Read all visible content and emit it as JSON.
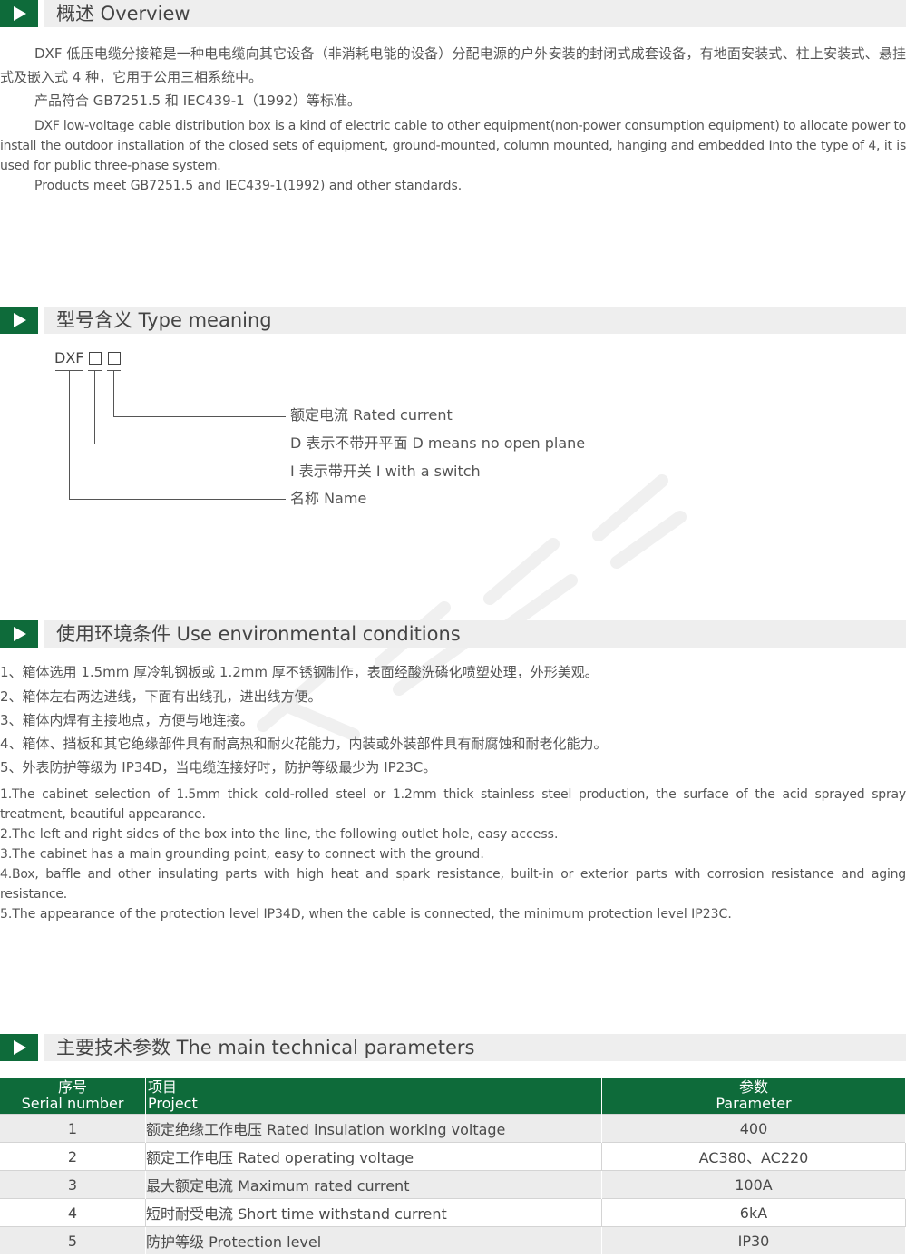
{
  "sections": {
    "overview": {
      "title": "概述 Overview",
      "paragraphs": [
        "DXF 低压电缆分接箱是一种电电缆向其它设备（非消耗电能的设备）分配电源的户外安装的封闭式成套设备，有地面安装式、柱上安装式、悬挂式及嵌入式 4 种，它用于公用三相系统中。",
        "产品符合 GB7251.5 和 IEC439-1（1992）等标准。",
        "DXF low-voltage cable distribution box is a kind of electric cable to other equipment(non-power consumption equipment) to allocate power to install the outdoor installation of the closed sets of equipment, ground-mounted, column mounted, hanging and embedded Into the type of 4, it is used for public three-phase system.",
        "Products meet GB7251.5 and IEC439-1(1992) and other standards."
      ]
    },
    "type_meaning": {
      "title": "型号含义 Type meaning",
      "code": "DXF",
      "labels": [
        "额定电流 Rated current",
        "D 表示不带开平面 D means no open plane",
        "I 表示带开关 I with a switch",
        "名称 Name"
      ]
    },
    "conditions": {
      "title": "使用环境条件 Use environmental conditions",
      "cn_items": [
        "1、箱体选用 1.5mm 厚冷轧钢板或 1.2mm 厚不锈钢制作，表面经酸洗磷化喷塑处理，外形美观。",
        "2、箱体左右两边进线，下面有出线孔，进出线方便。",
        "3、箱体内焊有主接地点，方便与地连接。",
        "4、箱体、挡板和其它绝缘部件具有耐高热和耐火花能力，内装或外装部件具有耐腐蚀和耐老化能力。",
        "5、外表防护等级为 IP34D，当电缆连接好时，防护等级最少为 IP23C。"
      ],
      "en_items": [
        "1.The cabinet selection of 1.5mm thick cold-rolled steel or 1.2mm thick stainless steel production, the surface of the acid sprayed spray treatment, beautiful appearance.",
        "2.The left and right sides of the box into the line, the following outlet hole, easy access.",
        "3.The cabinet has a main grounding point, easy to connect with the ground.",
        "4.Box, baffle and other insulating parts with high heat and spark resistance, built-in or exterior parts with corrosion resistance and aging resistance.",
        "5.The appearance of the protection level IP34D, when the cable is connected, the minimum protection level IP23C."
      ]
    },
    "parameters": {
      "title": "主要技术参数 The main technical parameters",
      "headers": {
        "serial_cn": "序号",
        "serial_en": "Serial number",
        "project_cn": "项目",
        "project_en": "Project",
        "param_cn": "参数",
        "param_en": "Parameter"
      },
      "rows": [
        {
          "no": "1",
          "project": "额定绝缘工作电压 Rated insulation working voltage",
          "value": "400"
        },
        {
          "no": "2",
          "project": "额定工作电压 Rated operating voltage",
          "value": "AC380、AC220"
        },
        {
          "no": "3",
          "project": "最大额定电流 Maximum rated current",
          "value": "100A"
        },
        {
          "no": "4",
          "project": "短时耐受电流 Short time withstand current",
          "value": "6kA"
        },
        {
          "no": "5",
          "project": "防护等级 Protection level",
          "value": "IP30"
        }
      ]
    }
  },
  "colors": {
    "accent": "#0e6b3a",
    "section_bar": "#eeeeee",
    "row_alt": "#ececec"
  }
}
